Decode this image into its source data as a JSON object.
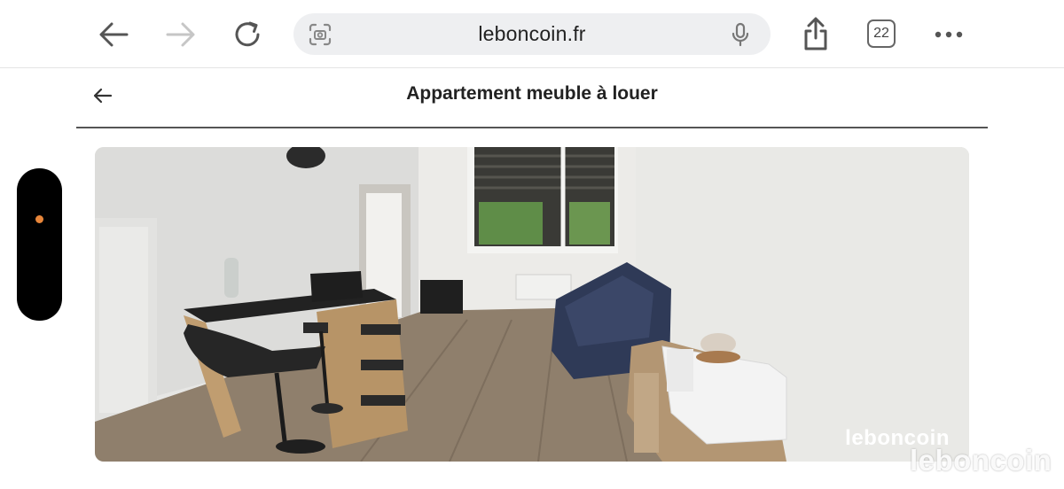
{
  "browser": {
    "url": "leboncoin.fr",
    "tab_count": "22"
  },
  "page": {
    "title": "Appartement meuble à louer"
  },
  "listing_photo": {
    "watermark": "leboncoin",
    "overlay_watermark": "leboncoin"
  },
  "colors": {
    "handle": "#000000",
    "handle_dot": "#e8863a",
    "url_bar_bg": "#eeeff1"
  },
  "icons": [
    "back-arrow-icon",
    "forward-arrow-icon",
    "reload-icon",
    "camera-search-icon",
    "microphone-icon",
    "share-icon",
    "more-icon"
  ]
}
